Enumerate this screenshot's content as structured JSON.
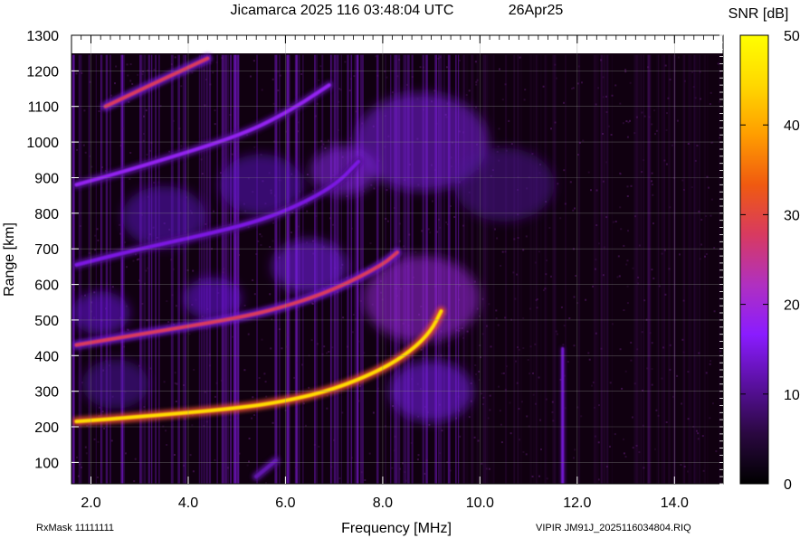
{
  "chart_data": {
    "type": "heatmap",
    "title": "Jicamarca 2025 116 03:48:04 UTC",
    "date_label": "26Apr25",
    "xlabel": "Frequency [MHz]",
    "ylabel": "Range [km]",
    "xlim": [
      1.6,
      15.0
    ],
    "ylim": [
      40,
      1300
    ],
    "x_ticks": [
      "2.0",
      "4.0",
      "6.0",
      "8.0",
      "10.0",
      "12.0",
      "14.0"
    ],
    "x_tick_values": [
      2,
      4,
      6,
      8,
      10,
      12,
      14
    ],
    "y_ticks": [
      "100",
      "200",
      "300",
      "400",
      "500",
      "600",
      "700",
      "800",
      "900",
      "1000",
      "1100",
      "1200",
      "1300"
    ],
    "y_tick_values": [
      100,
      200,
      300,
      400,
      500,
      600,
      700,
      800,
      900,
      1000,
      1100,
      1200,
      1300
    ],
    "grid": true,
    "data_top_km": 1245,
    "colorbar": {
      "label": "SNR [dB]",
      "range": [
        0,
        50
      ],
      "ticks": [
        "0",
        "10",
        "20",
        "30",
        "40",
        "50"
      ],
      "tick_values": [
        0,
        10,
        20,
        30,
        40,
        50
      ],
      "colormap": [
        "#000000",
        "#2a0840",
        "#5a10a0",
        "#8a1cff",
        "#b030c0",
        "#d83a60",
        "#f05a10",
        "#ff9d00",
        "#ffd800",
        "#ffff00"
      ]
    },
    "traces": [
      {
        "name": "O-trace",
        "points": [
          [
            1.7,
            215
          ],
          [
            3,
            228
          ],
          [
            5,
            252
          ],
          [
            6,
            272
          ],
          [
            7,
            305
          ],
          [
            8,
            362
          ],
          [
            8.6,
            415
          ],
          [
            9,
            470
          ],
          [
            9.2,
            525
          ]
        ],
        "snr": 45
      },
      {
        "name": "X-trace",
        "points": [
          [
            5.4,
            60
          ],
          [
            5.8,
            105
          ]
        ],
        "snr": 12
      },
      {
        "name": "O-multihop-2",
        "points": [
          [
            1.7,
            430
          ],
          [
            3,
            460
          ],
          [
            5,
            505
          ],
          [
            6,
            538
          ],
          [
            7,
            585
          ],
          [
            8,
            655
          ],
          [
            8.3,
            690
          ]
        ],
        "snr": 28
      },
      {
        "name": "O-multihop-3",
        "points": [
          [
            1.7,
            655
          ],
          [
            3,
            700
          ],
          [
            5,
            760
          ],
          [
            6,
            805
          ],
          [
            7,
            875
          ],
          [
            7.5,
            945
          ]
        ],
        "snr": 15
      },
      {
        "name": "O-multihop-4",
        "points": [
          [
            1.7,
            880
          ],
          [
            3,
            930
          ],
          [
            5,
            1015
          ],
          [
            6,
            1080
          ],
          [
            6.9,
            1160
          ]
        ],
        "snr": 18
      },
      {
        "name": "O-multihop-5",
        "points": [
          [
            2.3,
            1100
          ],
          [
            3.3,
            1165
          ],
          [
            4.4,
            1235
          ]
        ],
        "snr": 28
      },
      {
        "name": "vertical-interference",
        "points": [
          [
            11.7,
            40
          ],
          [
            11.7,
            420
          ]
        ],
        "snr": 14
      }
    ]
  },
  "footer": {
    "rxmask": "RxMask 11111111",
    "file": "VIPIR  JM91J_2025116034804.RIQ"
  }
}
